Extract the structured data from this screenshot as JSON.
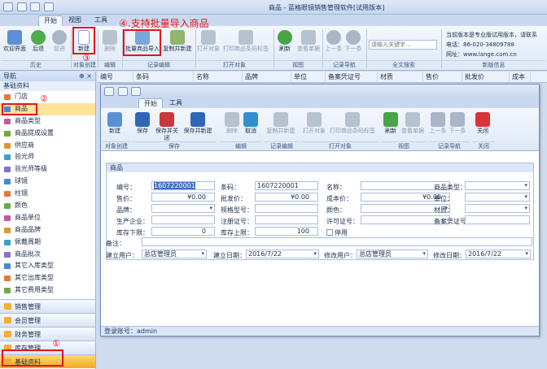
{
  "app": {
    "title": "商品 - 蓝格眼镜销售管理软件[试用版本]"
  },
  "main_tabs": [
    "开始",
    "视图",
    "工具"
  ],
  "ribbon": {
    "buttons": [
      "欢迎界面",
      "后退",
      "前进",
      "新建",
      "删除",
      "批量商品导入",
      "复制并新建",
      "打开对象",
      "打印商品条码标签",
      "刷新",
      "查看单据",
      "上一条",
      "下一条"
    ],
    "groups": [
      "历史",
      "对象创建",
      "编辑",
      "记录编辑",
      "打开对象",
      "视图",
      "记录导航",
      "全文搜索",
      "新版信息"
    ],
    "search_placeholder": "请输入关键字...",
    "info_line1": "当前版本是专业版试用版本，请联系",
    "phone": "电话：86-020-34809788",
    "website": "网址：www.lange.com.cn"
  },
  "annotations": {
    "step1": "①",
    "step2": "②",
    "step3": "③",
    "step4": "④.支持批量导入商品"
  },
  "nav": {
    "title": "导航",
    "section": "基础资料",
    "items": [
      "门店",
      "商品",
      "商品类型",
      "商品提成设置",
      "供应商",
      "验光师",
      "验光师等级",
      "球镜",
      "柱镜",
      "颜色",
      "商品单位",
      "商品品牌",
      "佩戴周期",
      "商品批次",
      "其它入库类型",
      "其它出库类型",
      "其它费用类型"
    ],
    "footer": [
      "销售管理",
      "会员管理",
      "财务管理",
      "库存管理",
      "基础资料"
    ]
  },
  "grid": {
    "columns": [
      "编号",
      "条码",
      "名称",
      "品牌",
      "单位",
      "备案凭证号",
      "材质",
      "售价",
      "批发价",
      "成本"
    ]
  },
  "dialog": {
    "tabs": [
      "开始",
      "工具"
    ],
    "buttons": [
      "新建",
      "保存",
      "保存并关闭",
      "保存并新建",
      "删除",
      "取消",
      "复制并新建",
      "打开对象",
      "打印商品条码标签",
      "刷新",
      "查看单据",
      "上一条",
      "下一条",
      "关闭"
    ],
    "groups": [
      "对象创建",
      "保存",
      "编辑",
      "记录编辑",
      "打开对象",
      "视图",
      "记录导航",
      "关闭"
    ],
    "section": "商品",
    "fields": {
      "code_label": "编号：",
      "code": "1607220001",
      "barcode_label": "条码：",
      "barcode": "1607220001",
      "name_label": "名称：",
      "name": "",
      "type_label": "商品类型：",
      "type": "",
      "price_label": "售价：",
      "price": "¥0.00",
      "wholesale_label": "批发价：",
      "wholesale": "¥0.00",
      "cost_label": "成本价：",
      "cost": "¥0.00",
      "unit_label": "单位：",
      "unit": "",
      "brand_label": "品牌：",
      "brand": "",
      "spec_label": "规格型号：",
      "spec": "",
      "color_label": "颜色：",
      "color": "",
      "material_label": "材质：",
      "material": "",
      "maker_label": "生产企业：",
      "maker": "",
      "reg_label": "注册证号：",
      "reg": "",
      "license_label": "许可证号：",
      "license": "",
      "record_label": "备案凭证号：",
      "record": "",
      "minstock_label": "库存下限：",
      "minstock": "0",
      "maxstock_label": "库存上限：",
      "maxstock": "100",
      "disable_label": "停用",
      "note_label": "备注：",
      "note": "",
      "creator_label": "建立用户：",
      "creator": "总店管理员",
      "cdate_label": "建立日期：",
      "cdate": "2016/7/22",
      "modifier_label": "修改用户：",
      "modifier": "总店管理员",
      "mdate_label": "修改日期：",
      "mdate": "2016/7/22"
    },
    "status": "登录账号：admin"
  }
}
